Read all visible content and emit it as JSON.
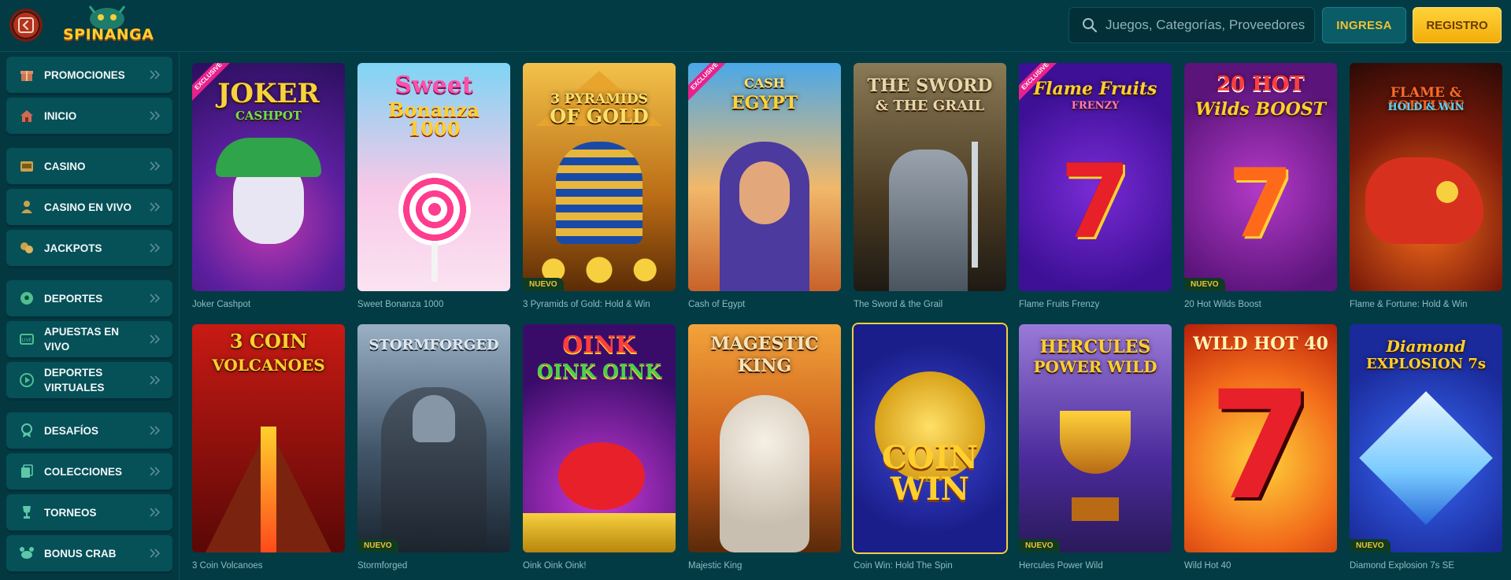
{
  "header": {
    "search_placeholder": "Juegos, Categorías, Proveedores",
    "login_label": "INGRESA",
    "register_label": "REGISTRO",
    "logo_text": "SPINANGA"
  },
  "sidebar": {
    "items": [
      {
        "label": "PROMOCIONES",
        "icon": "gift-icon"
      },
      {
        "label": "INICIO",
        "icon": "home-icon"
      },
      {
        "label": "CASINO",
        "icon": "casino-icon"
      },
      {
        "label": "CASINO EN VIVO",
        "icon": "live-dealer-icon"
      },
      {
        "label": "JACKPOTS",
        "icon": "coins-icon"
      },
      {
        "label": "DEPORTES",
        "icon": "soccer-ball-icon"
      },
      {
        "label": "APUESTAS EN VIVO",
        "icon": "live-bet-icon"
      },
      {
        "label": "DEPORTES VIRTUALES",
        "icon": "play-circle-icon"
      },
      {
        "label": "DESAFÍOS",
        "icon": "challenge-icon"
      },
      {
        "label": "COLECCIONES",
        "icon": "collection-icon"
      },
      {
        "label": "TORNEOS",
        "icon": "trophy-icon"
      },
      {
        "label": "BONUS CRAB",
        "icon": "crab-icon"
      }
    ]
  },
  "games": {
    "row1": [
      {
        "caption": "Joker Cashpot",
        "title": "JOKER",
        "subtitle": "CASHPOT",
        "ribbon": "EXCLUSIVE",
        "badge": ""
      },
      {
        "caption": "Sweet Bonanza 1000",
        "title": "Sweet",
        "subtitle": "Bonanza 1000",
        "ribbon": "",
        "badge": ""
      },
      {
        "caption": "3 Pyramids of Gold: Hold & Win",
        "title": "3 PYRAMIDS",
        "subtitle": "OF GOLD",
        "ribbon": "",
        "badge": "NUEVO"
      },
      {
        "caption": "Cash of Egypt",
        "title": "CASH",
        "subtitle": "EGYPT",
        "ribbon": "EXCLUSIVE",
        "badge": ""
      },
      {
        "caption": "The Sword & the Grail",
        "title": "THE SWORD",
        "subtitle": "& THE GRAIL",
        "ribbon": "",
        "badge": ""
      },
      {
        "caption": "Flame Fruits Frenzy",
        "title": "Flame Fruits",
        "subtitle": "FRENZY",
        "ribbon": "EXCLUSIVE",
        "badge": ""
      },
      {
        "caption": "20 Hot Wilds Boost",
        "title": "20 HOT",
        "subtitle": "Wilds BOOST",
        "ribbon": "",
        "badge": "NUEVO"
      },
      {
        "caption": "Flame & Fortune: Hold & Win",
        "title": "FLAME & FORTUNE",
        "subtitle": "HOLD & WIN",
        "ribbon": "",
        "badge": ""
      }
    ],
    "row2": [
      {
        "caption": "3 Coin Volcanoes",
        "title": "3 COIN",
        "subtitle": "VOLCANOES",
        "ribbon": "",
        "badge": ""
      },
      {
        "caption": "Stormforged",
        "title": "STORMFORGED",
        "subtitle": "",
        "ribbon": "",
        "badge": "NUEVO"
      },
      {
        "caption": "Oink Oink Oink!",
        "title": "OINK",
        "subtitle": "OINK OINK",
        "ribbon": "",
        "badge": ""
      },
      {
        "caption": "Majestic King",
        "title": "MAGESTIC",
        "subtitle": "KING",
        "ribbon": "",
        "badge": ""
      },
      {
        "caption": "Coin Win: Hold The Spin",
        "title": "COIN",
        "subtitle": "WIN",
        "ribbon": "",
        "badge": ""
      },
      {
        "caption": "Hercules Power Wild",
        "title": "HERCULES",
        "subtitle": "POWER WILD",
        "ribbon": "",
        "badge": "NUEVO"
      },
      {
        "caption": "Wild Hot 40",
        "title": "WILD HOT 40",
        "subtitle": "",
        "ribbon": "",
        "badge": ""
      },
      {
        "caption": "Diamond Explosion 7s SE",
        "title": "Diamond",
        "subtitle": "EXPLOSION 7s",
        "ribbon": "",
        "badge": "NUEVO"
      }
    ]
  },
  "colors": {
    "background": "#023b44",
    "accent": "#f2ad08",
    "nav_item": "#065058"
  }
}
